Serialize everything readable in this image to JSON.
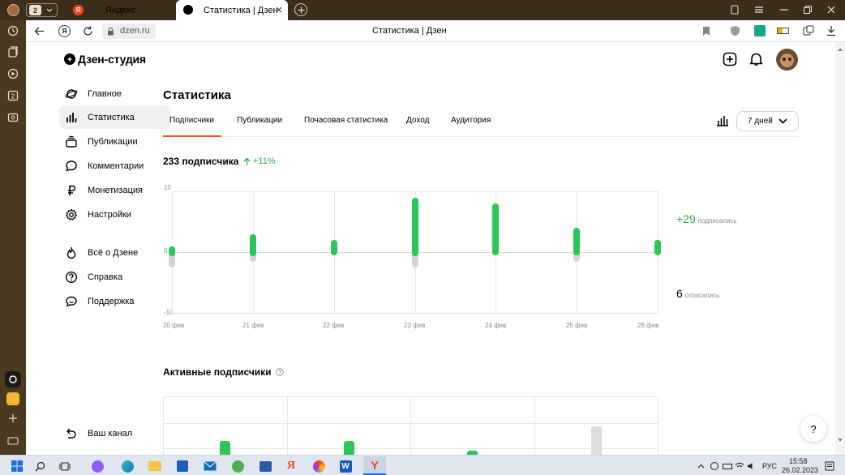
{
  "browser": {
    "tab_count": "2",
    "tabs": [
      {
        "label": "Яндекс",
        "active": false
      },
      {
        "label": "Статистика | Дзен",
        "active": true
      }
    ],
    "url": "dzen.ru",
    "page_title": "Статистика | Дзен"
  },
  "studio": {
    "logo_text": "Дзен-студия",
    "nav_main": [
      {
        "label": "Главное",
        "icon": "planet-icon"
      },
      {
        "label": "Статистика",
        "icon": "bar-chart-icon",
        "active": true
      },
      {
        "label": "Публикации",
        "icon": "stack-icon"
      },
      {
        "label": "Комментарии",
        "icon": "comment-icon"
      },
      {
        "label": "Монетизация",
        "icon": "ruble-icon"
      },
      {
        "label": "Настройки",
        "icon": "gear-icon"
      }
    ],
    "nav_extra": [
      {
        "label": "Всё о Дзене",
        "icon": "flame-icon"
      },
      {
        "label": "Справка",
        "icon": "help-icon"
      },
      {
        "label": "Поддержка",
        "icon": "chat-icon"
      }
    ],
    "channel_link": "Ваш канал"
  },
  "stats": {
    "heading": "Статистика",
    "tabs": [
      {
        "label": "Подписчики",
        "active": true
      },
      {
        "label": "Публикации"
      },
      {
        "label": "Почасовая статистика"
      },
      {
        "label": "Доход"
      },
      {
        "label": "Аудитория"
      }
    ],
    "period": "7 дней",
    "subscribers_total": "233 подписчика",
    "growth": "+11%",
    "subscribed_value": "+29",
    "subscribed_label": "подписались",
    "unsubscribed_value": "6",
    "unsubscribed_label": "отписались",
    "active_heading": "Активные подписчики",
    "help_button": "?"
  },
  "chart_data": [
    {
      "type": "bar",
      "categories": [
        "20 фев",
        "21 фев",
        "22 фев",
        "23 фев",
        "24 фев",
        "25 фев",
        "26 фев"
      ],
      "series": [
        {
          "name": "подписались",
          "color": "#2bc655",
          "values": [
            1,
            3,
            2,
            9,
            8,
            4,
            2
          ]
        },
        {
          "name": "отписались",
          "color": "#d4d4d4",
          "values": [
            -2,
            -1,
            0,
            -2,
            0,
            -1,
            0
          ]
        }
      ],
      "ylim": [
        -10,
        10
      ],
      "yticks": [
        "10",
        "0",
        "-10"
      ],
      "grid": true
    },
    {
      "type": "bar",
      "series": [
        {
          "color": "#2bc655",
          "values": [
            0.4,
            0.4,
            0.3
          ]
        },
        {
          "color": "#dcdcdc",
          "values": [
            0.55
          ]
        }
      ]
    }
  ],
  "taskbar": {
    "language": "РУС",
    "time": "15:58",
    "date": "26.02.2023"
  }
}
